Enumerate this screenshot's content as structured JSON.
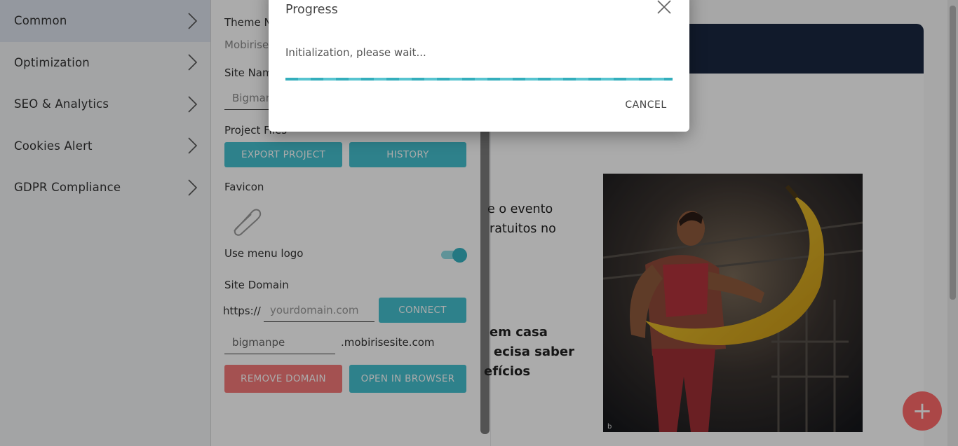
{
  "menu": {
    "items": [
      {
        "label": "Common"
      },
      {
        "label": "Optimization"
      },
      {
        "label": "SEO & Analytics"
      },
      {
        "label": "Cookies Alert"
      },
      {
        "label": "GDPR Compliance"
      }
    ]
  },
  "panel": {
    "theme_name_label": "Theme N",
    "theme_name_value": "Mobirise",
    "site_name_label": "Site Nam",
    "site_name_value": "Bigman",
    "project_files_label": "Project Files",
    "export_button": "EXPORT PROJECT",
    "history_button": "HISTORY",
    "favicon_label": "Favicon",
    "use_menu_logo_label": "Use menu logo",
    "use_menu_logo_on": true,
    "site_domain_label": "Site Domain",
    "https_prefix": "https://",
    "domain_placeholder": "yourdomain.com",
    "connect_button": "CONNECT",
    "subdomain_value": "bigmanpe",
    "subdomain_suffix": ".mobirisesite.com",
    "remove_domain_button": "REMOVE DOMAIN",
    "open_browser_button": "OPEN IN BROWSER"
  },
  "preview": {
    "text_line1": "e o evento",
    "text_line2": "ratuitos no",
    "heading_line1": "em casa",
    "heading_line2": "ecisa saber",
    "heading_line3": "efícios"
  },
  "dialog": {
    "title": "Progress",
    "message": "Initialization, please wait...",
    "progress": 1.0,
    "cancel_button": "CANCEL"
  },
  "colors": {
    "accent": "#45c1cf",
    "danger": "#f57a7a",
    "fab": "#ff6b6b",
    "site_navbar": "#1a2840"
  },
  "icons": {
    "menu_chevron": "chevron-right-icon",
    "dialog_close": "close-icon",
    "fab": "plus-icon",
    "favicon": "paperclip-icon"
  }
}
